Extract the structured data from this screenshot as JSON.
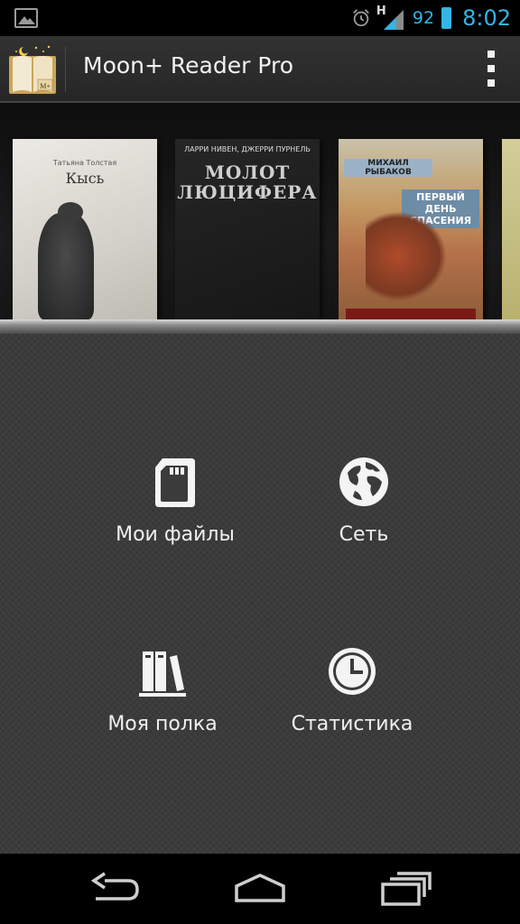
{
  "status_bar": {
    "gallery_icon": "picture-icon",
    "alarm_icon": "alarm-clock-icon",
    "network_type": "H",
    "signal_icon": "signal-icon",
    "battery_percent": "92",
    "battery_icon": "battery-icon",
    "time": "8:02",
    "accent_color": "#33b5e5"
  },
  "action_bar": {
    "app_icon": "moon-reader-book-icon",
    "logo_text": "M+",
    "title": "Moon+ Reader Pro",
    "overflow_icon": "overflow-menu-icon"
  },
  "bookshelf": {
    "books": [
      {
        "author": "Татьяна Толстая",
        "title": "Кысь"
      },
      {
        "author": "ЛАРРИ НИВЕН, ДЖЕРРИ ПУРНЕЛЬ",
        "title": "МОЛОТ ЛЮЦИФЕРА"
      },
      {
        "author": "МИХАИЛ РЫБАКОВ",
        "title": "ПЕРВЫЙ ДЕНЬ СПАСЕНИЯ"
      }
    ]
  },
  "menu": {
    "my_files": {
      "label": "Мои файлы",
      "icon": "sd-card-icon"
    },
    "network": {
      "label": "Сеть",
      "icon": "globe-icon"
    },
    "my_shelf": {
      "label": "Моя полка",
      "icon": "books-icon"
    },
    "statistics": {
      "label": "Статистика",
      "icon": "clock-icon"
    }
  },
  "nav_bar": {
    "back_icon": "back-icon",
    "home_icon": "home-icon",
    "recent_icon": "recent-apps-icon"
  }
}
